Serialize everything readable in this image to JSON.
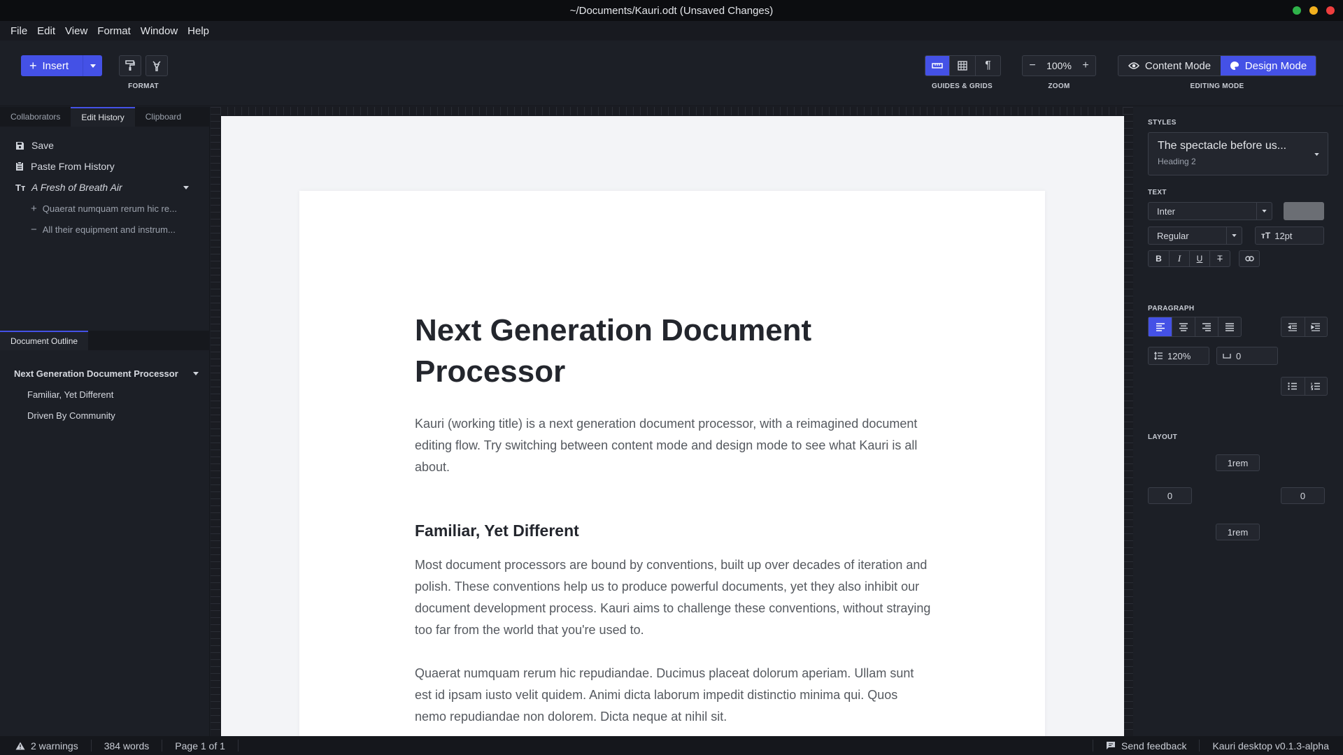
{
  "window": {
    "title": "~/Documents/Kauri.odt (Unsaved Changes)",
    "traffic_colors": [
      "#2fb24a",
      "#f2b01e",
      "#ee3e3e"
    ]
  },
  "menu": [
    "File",
    "Edit",
    "View",
    "Format",
    "Window",
    "Help"
  ],
  "toolbar": {
    "insert_label": "Insert",
    "format_label": "FORMAT",
    "guides_label": "GUIDES & GRIDS",
    "zoom_label": "ZOOM",
    "zoom_value": "100%",
    "zoom_minus": "−",
    "zoom_plus": "+",
    "editing_mode_label": "EDITING MODE",
    "content_mode": "Content Mode",
    "design_mode": "Design Mode"
  },
  "left_tabs": [
    "Collaborators",
    "Edit History",
    "Clipboard"
  ],
  "history": {
    "save": "Save",
    "paste": "Paste From History",
    "entry": "A Fresh of Breath Air",
    "sub_add": "Quaerat numquam rerum hic re...",
    "sub_remove": "All their equipment and instrum..."
  },
  "outline": {
    "tab": "Document Outline",
    "top": "Next Generation Document Processor",
    "children": [
      "Familiar, Yet Different",
      "Driven By Community"
    ]
  },
  "document": {
    "h1": "Next Generation Document Processor",
    "p1": "Kauri (working title) is a next generation document processor, with a reimagined document editing flow. Try switching between content mode and design mode to see what Kauri is all about.",
    "h2": "Familiar, Yet Different",
    "p2": "Most document processors are bound by conventions, built up over decades of iteration and polish. These conventions help us to produce powerful documents, yet they also inhibit our document development process. Kauri aims to challenge these conventions, without straying too far from the world that you're used to.",
    "p3": "Quaerat numquam rerum hic repudiandae. Ducimus placeat dolorum aperiam. Ullam sunt est id ipsam iusto velit quidem. Animi dicta laborum impedit distinctio minima qui. Quos nemo repudiandae non dolorem. Dicta neque at nihil sit."
  },
  "styles": {
    "label": "STYLES",
    "preview": "The spectacle before us...",
    "style_name": "Heading 2"
  },
  "text": {
    "label": "TEXT",
    "font": "Inter",
    "weight": "Regular",
    "size": "12pt",
    "color": "#6b6e74"
  },
  "paragraph": {
    "label": "PARAGRAPH",
    "line_height": "120%",
    "spacing": "0"
  },
  "layout": {
    "label": "LAYOUT",
    "top": "1rem",
    "left": "0",
    "right": "0",
    "bottom": "1rem"
  },
  "status": {
    "warnings": "2 warnings",
    "words": "384 words",
    "page": "Page 1 of 1",
    "feedback": "Send feedback",
    "version": "Kauri desktop v0.1.3-alpha"
  },
  "accent": "#4451e6"
}
